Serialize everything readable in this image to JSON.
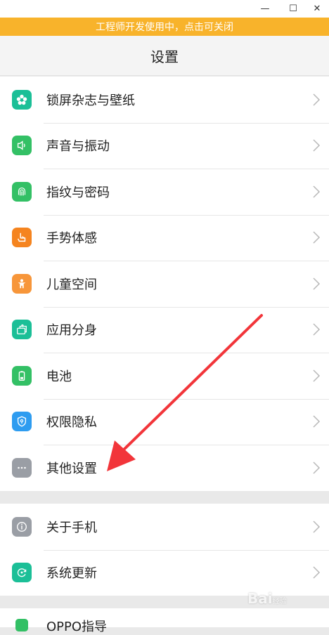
{
  "window": {
    "minimize_glyph": "—",
    "maximize_glyph": "☐",
    "close_glyph": "✕"
  },
  "banner": {
    "text": "工程师开发使用中，点击可关闭"
  },
  "header": {
    "title": "设置"
  },
  "group1": [
    {
      "label": "锁屏杂志与壁纸",
      "icon": "flower-icon",
      "color": "#1bbf97"
    },
    {
      "label": "声音与振动",
      "icon": "speaker-icon",
      "color": "#33c065"
    },
    {
      "label": "指纹与密码",
      "icon": "fingerprint-icon",
      "color": "#33c065"
    },
    {
      "label": "手势体感",
      "icon": "hand-gesture-icon",
      "color": "#f5841f"
    },
    {
      "label": "儿童空间",
      "icon": "child-icon",
      "color": "#f7963a"
    },
    {
      "label": "应用分身",
      "icon": "app-clone-icon",
      "color": "#1bbf97"
    },
    {
      "label": "电池",
      "icon": "battery-icon",
      "color": "#33c065"
    },
    {
      "label": "权限隐私",
      "icon": "shield-icon",
      "color": "#2e9cf0"
    },
    {
      "label": "其他设置",
      "icon": "more-dots-icon",
      "color": "#9a9ea5"
    }
  ],
  "group2": [
    {
      "label": "关于手机",
      "icon": "info-icon",
      "color": "#9a9ea5"
    },
    {
      "label": "系统更新",
      "icon": "update-icon",
      "color": "#1bbf97"
    }
  ],
  "group3": [
    {
      "label": "OPPO指导",
      "icon": "guide-icon",
      "color": "#33c065"
    }
  ],
  "watermark": {
    "text": "Bai",
    "sub": "经验",
    "suffix": "du"
  }
}
